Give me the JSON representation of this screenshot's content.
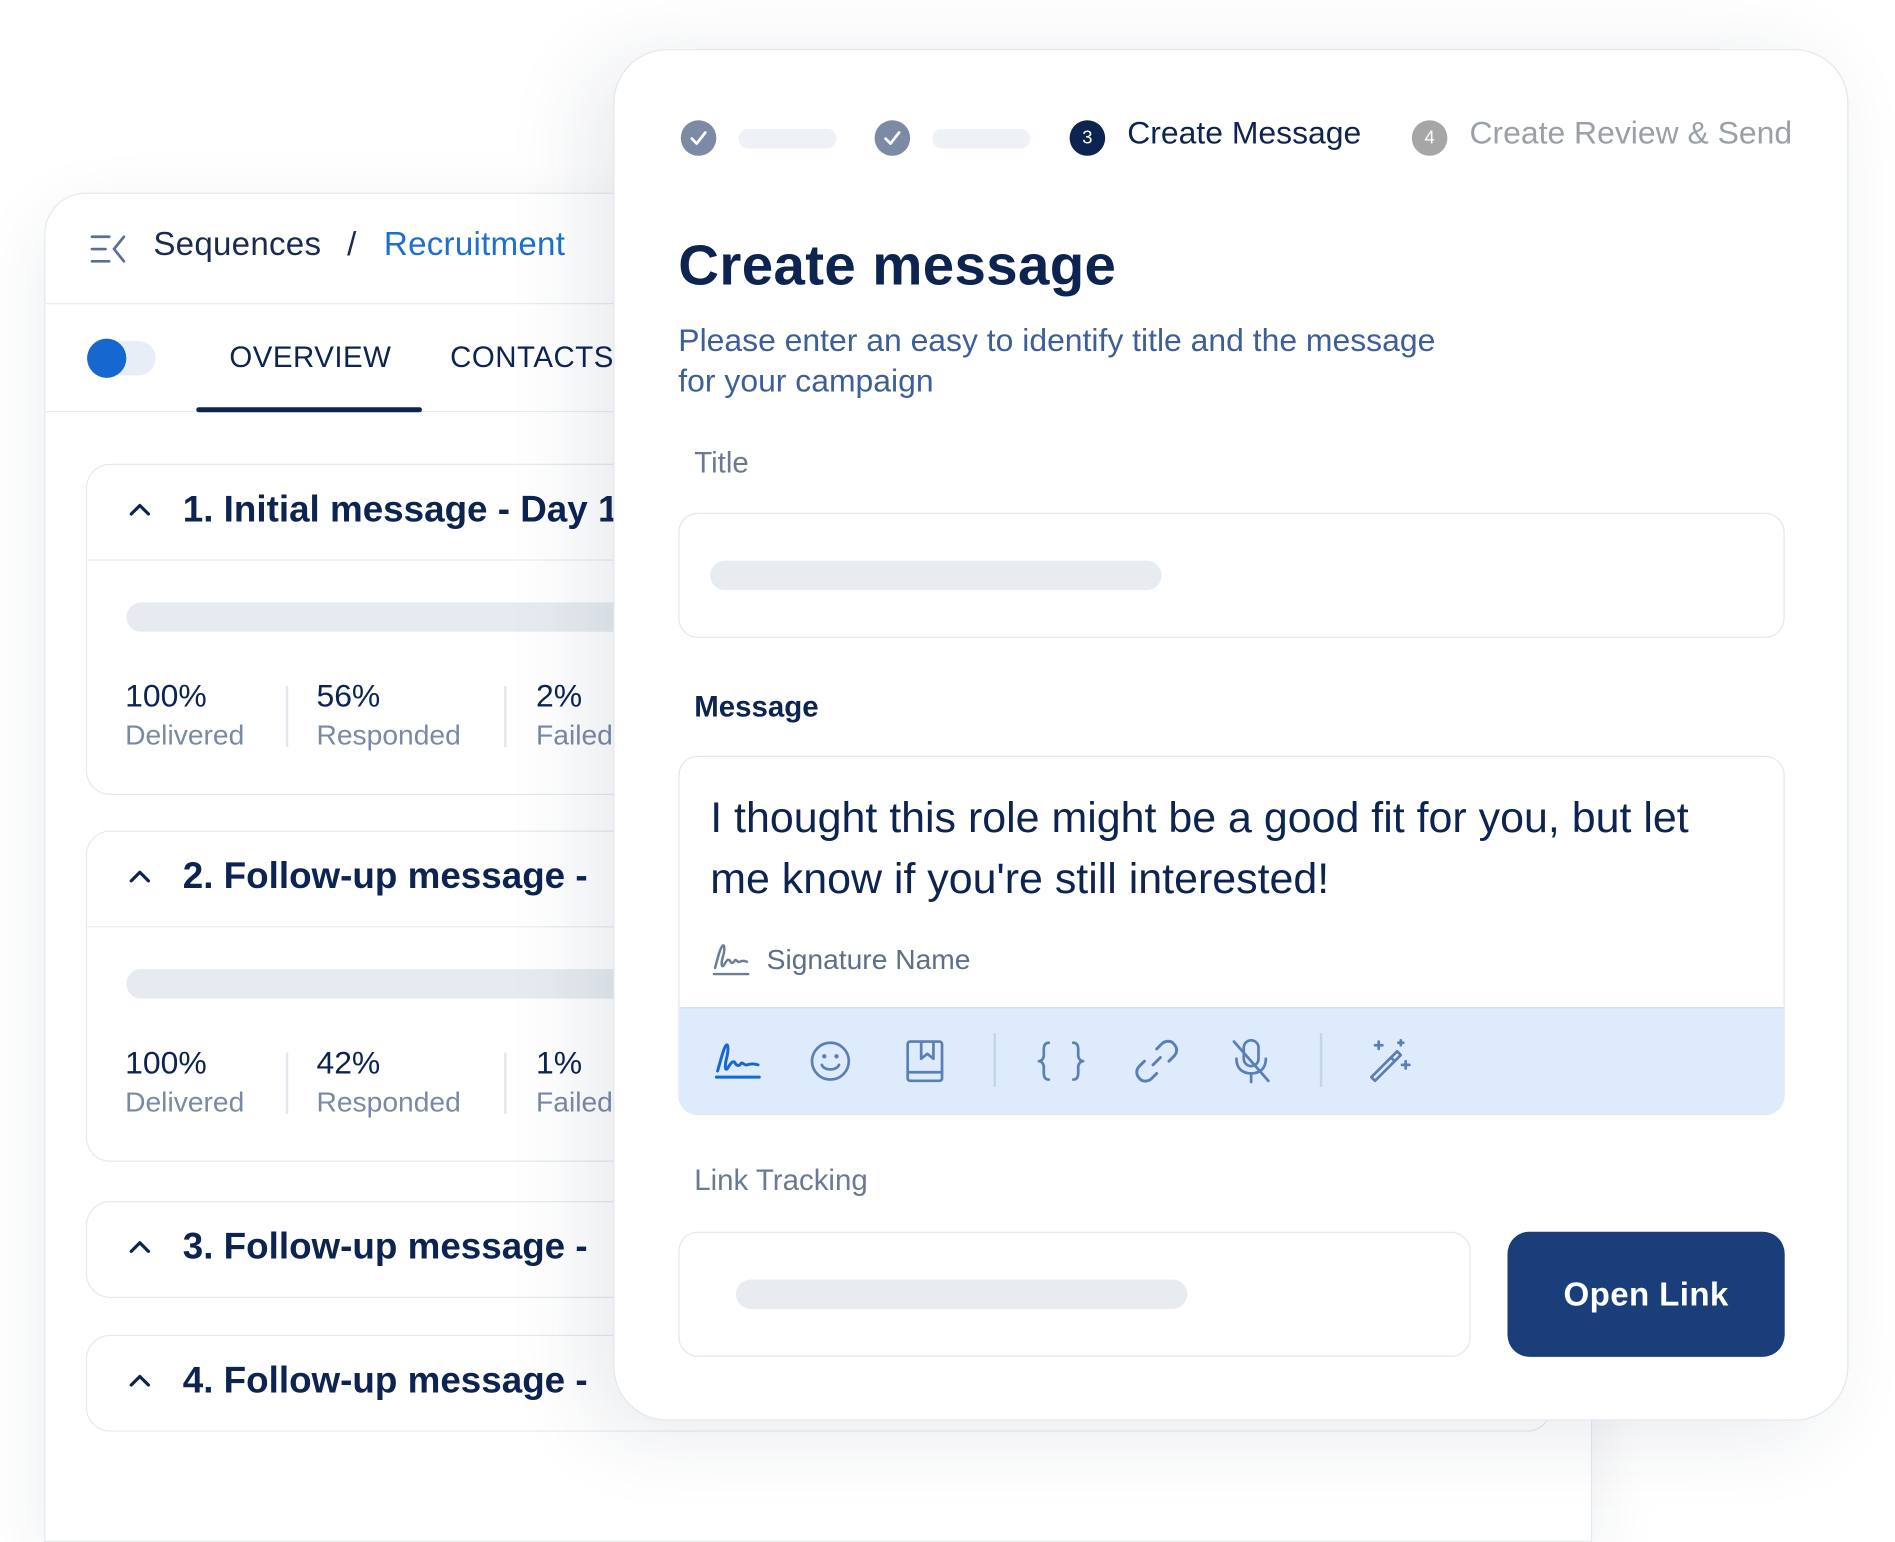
{
  "breadcrumb": {
    "root": "Sequences",
    "separator": "/",
    "current": "Recruitment"
  },
  "tabs": {
    "overview": "OVERVIEW",
    "contacts": "CONTACTS"
  },
  "sequences": [
    {
      "title": "1. Initial message - Day 1",
      "expanded": true,
      "stats": [
        {
          "value": "100%",
          "label": "Delivered"
        },
        {
          "value": "56%",
          "label": "Responded"
        },
        {
          "value": "2%",
          "label": "Failed"
        }
      ]
    },
    {
      "title": "2. Follow-up message -",
      "expanded": true,
      "stats": [
        {
          "value": "100%",
          "label": "Delivered"
        },
        {
          "value": "42%",
          "label": "Responded"
        },
        {
          "value": "1%",
          "label": "Failed"
        }
      ]
    },
    {
      "title": "3. Follow-up message -",
      "expanded": false
    },
    {
      "title": "4. Follow-up message -",
      "expanded": false
    }
  ],
  "stepper": {
    "step3_number": "3",
    "step3_label": "Create Message",
    "step4_number": "4",
    "step4_label": "Create Review & Send"
  },
  "modal": {
    "title": "Create message",
    "subtitle": "Please enter an easy to identify title and the message for your campaign",
    "title_label": "Title",
    "message_label": "Message",
    "message_text": "I thought this role might be a good fit for you, but let me know if you're still interested!",
    "signature_name": "Signature Name",
    "link_tracking_label": "Link Tracking",
    "open_link_button": "Open Link"
  },
  "toolbar_icons": [
    "signature-icon",
    "emoji-icon",
    "bookmark-icon",
    "braces-icon",
    "link-icon",
    "mic-off-icon",
    "magic-wand-icon"
  ],
  "colors": {
    "navy": "#0d2350",
    "accent_blue": "#1d6fd0",
    "button_blue": "#1a3e7a",
    "toolbar_bg": "#ddebfd"
  }
}
